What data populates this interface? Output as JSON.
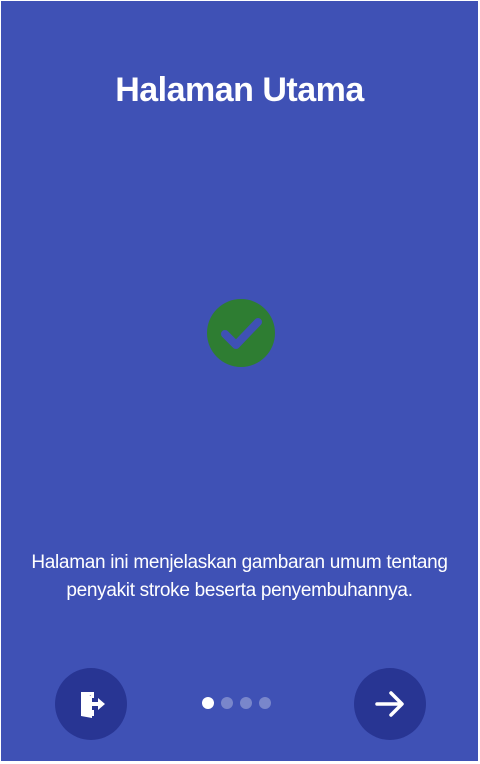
{
  "page": {
    "title": "Halaman Utama",
    "description": "Halaman ini menjelaskan gambaran umum tentang penyakit stroke beserta penyembuhannya."
  },
  "status_icon": "check-circle-icon",
  "pager": {
    "total": 4,
    "current": 1
  },
  "buttons": {
    "exit_icon": "exit-door-icon",
    "next_icon": "arrow-right-icon"
  },
  "colors": {
    "background": "#3f51b5",
    "button": "#283593",
    "check": "#2e7d32",
    "dot_active": "#ffffff",
    "dot_inactive": "#7986cb"
  }
}
